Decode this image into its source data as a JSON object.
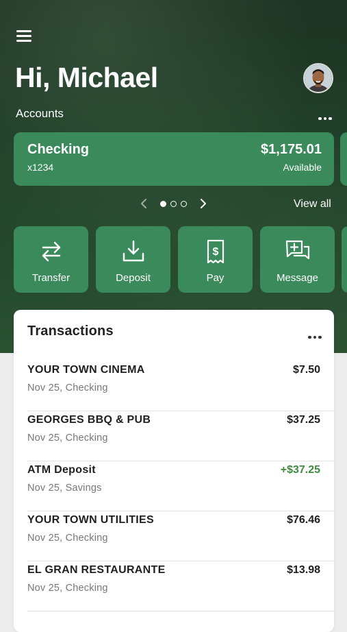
{
  "header": {
    "greeting": "Hi, Michael"
  },
  "accounts": {
    "label": "Accounts",
    "cards": [
      {
        "name": "Checking",
        "number": "x1234",
        "balance": "$1,175.01",
        "balance_label": "Available"
      }
    ],
    "pager": {
      "total": 3,
      "active": 1
    },
    "view_all": "View all"
  },
  "actions": [
    {
      "label": "Transfer",
      "icon": "transfer-icon"
    },
    {
      "label": "Deposit",
      "icon": "deposit-icon"
    },
    {
      "label": "Pay",
      "icon": "pay-icon"
    },
    {
      "label": "Message",
      "icon": "message-icon"
    }
  ],
  "transactions": {
    "title": "Transactions",
    "items": [
      {
        "name": "YOUR TOWN CINEMA",
        "meta": "Nov 25, Checking",
        "amount": "$7.50",
        "credit": false
      },
      {
        "name": "GEORGES BBQ & PUB",
        "meta": "Nov 25, Checking",
        "amount": "$37.25",
        "credit": false
      },
      {
        "name": "ATM Deposit",
        "meta": "Nov 25, Savings",
        "amount": "+$37.25",
        "credit": true
      },
      {
        "name": "YOUR TOWN UTILITIES",
        "meta": "Nov 25, Checking",
        "amount": "$76.46",
        "credit": false
      },
      {
        "name": "EL GRAN RESTAURANTE",
        "meta": "Nov 25, Checking",
        "amount": "$13.98",
        "credit": false
      }
    ]
  },
  "colors": {
    "brand": "#3b8a5b",
    "credit": "#3f8a3f",
    "hero_dark": "#1c3b25"
  }
}
